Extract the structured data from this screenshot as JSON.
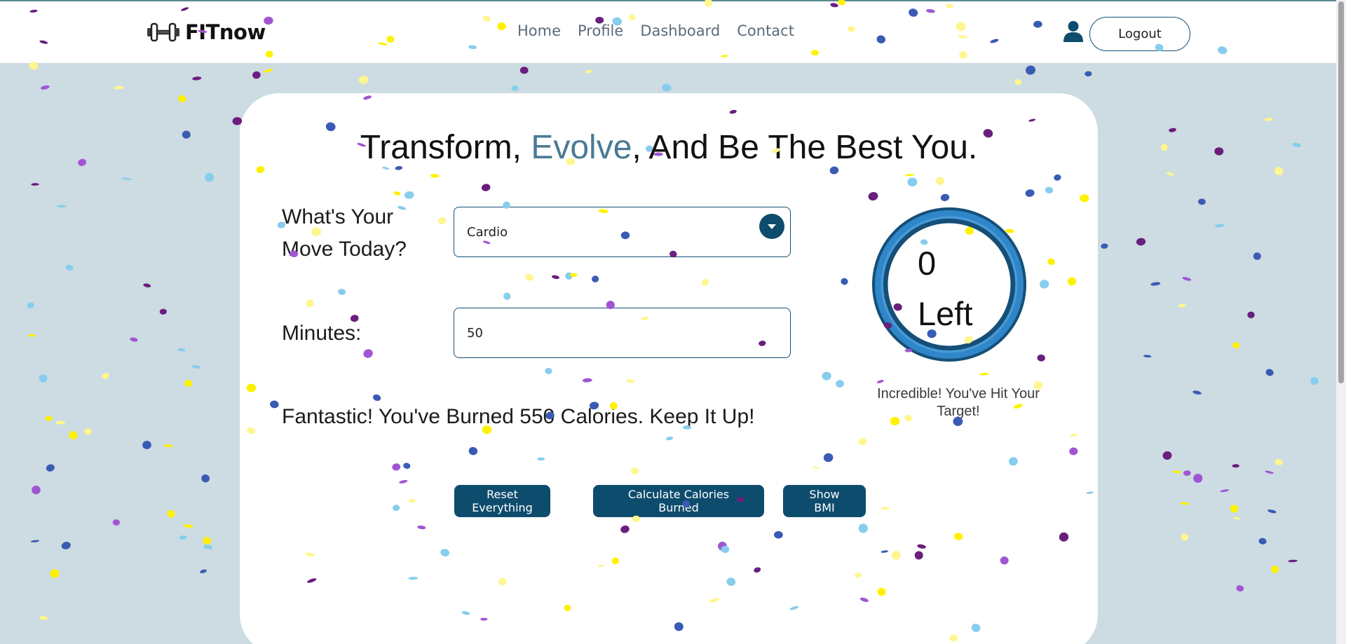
{
  "brand": {
    "name": "FITnow",
    "icon": "dumbbell-icon"
  },
  "nav": {
    "items": [
      "Home",
      "Profile",
      "Dashboard",
      "Contact"
    ]
  },
  "user": {
    "icon": "user-icon",
    "logout_label": "Logout"
  },
  "hero": {
    "part1": "Transform, ",
    "accent": "Evolve",
    "part2": ", And Be The Best You."
  },
  "form": {
    "move_label_line1": "What's Your",
    "move_label_line2": "Move Today?",
    "move_value": "Cardio",
    "minutes_label": "Minutes:",
    "minutes_value": "50"
  },
  "message": "Fantastic! You've Burned 550 Calories. Keep It Up!",
  "buttons": {
    "reset": "Reset Everything",
    "calculate": "Calculate Calories Burned",
    "bmi": "Show BMI"
  },
  "progress": {
    "remaining": "0",
    "remaining_label": "Left",
    "status": "Incredible! You've Hit Your Target!",
    "fraction_complete": 1.0
  },
  "colors": {
    "primary": "#0e4c6d",
    "accent_text": "#4b7a95",
    "background": "#cddbe2",
    "ring_fill": "#2f86c9",
    "ring_border": "#154f77",
    "confetti": [
      "#fef200",
      "#87cded",
      "#3a5bb4",
      "#a155d3",
      "#6a1e7e",
      "#fff68f"
    ]
  }
}
